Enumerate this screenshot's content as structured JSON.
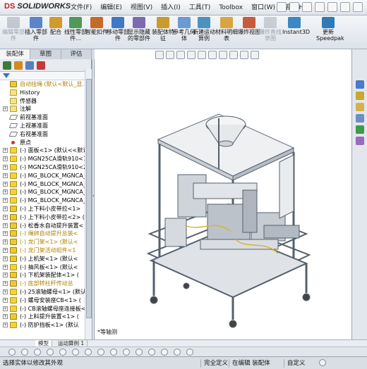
{
  "app": {
    "logo_prefix": "DS",
    "logo_name": "SOLIDWORKS"
  },
  "menu": [
    "文件(F)",
    "编辑(E)",
    "视图(V)",
    "插入(I)",
    "工具(T)",
    "Toolbox",
    "窗口(W)",
    "帮助(H)"
  ],
  "ribbon": [
    {
      "label": "编辑零部件",
      "disabled": true,
      "icon": "edit-component-icon"
    },
    {
      "label": "插入零部件",
      "disabled": false,
      "icon": "insert-component-icon"
    },
    {
      "label": "配合",
      "disabled": false,
      "icon": "mate-icon"
    },
    {
      "label": "线性零部件...",
      "disabled": false,
      "icon": "linear-pattern-icon"
    },
    {
      "label": "智能扣件",
      "disabled": false,
      "icon": "smart-fastener-icon"
    },
    {
      "label": "移动零部件",
      "disabled": false,
      "icon": "move-component-icon"
    },
    {
      "label": "显示隐藏的零部件",
      "disabled": false,
      "icon": "show-hidden-icon"
    },
    {
      "label": "装配体特征",
      "disabled": false,
      "icon": "assembly-feature-icon"
    },
    {
      "label": "参考几何体",
      "disabled": false,
      "icon": "reference-geometry-icon"
    },
    {
      "label": "新建运动算例",
      "disabled": false,
      "icon": "motion-study-icon"
    },
    {
      "label": "材料明细表",
      "disabled": false,
      "icon": "bom-icon"
    },
    {
      "label": "爆炸视图",
      "disabled": false,
      "icon": "exploded-view-icon"
    },
    {
      "label": "爆炸直线草图",
      "disabled": true,
      "icon": "explode-line-icon"
    },
    {
      "label": "Instant3D",
      "disabled": false,
      "icon": "instant3d-icon"
    },
    {
      "label": "更新Speedpak",
      "disabled": false,
      "icon": "speedpak-icon"
    }
  ],
  "panel_tabs": [
    "装配体",
    "草图",
    "评估"
  ],
  "tree": [
    {
      "text": "自动挂绳 (默认<默认_显...",
      "kind": "asm",
      "exp": "",
      "hl": true
    },
    {
      "text": "History",
      "kind": "fol",
      "exp": ""
    },
    {
      "text": "传感器",
      "kind": "fol",
      "exp": ""
    },
    {
      "text": "注解",
      "kind": "fol",
      "exp": "+"
    },
    {
      "text": "前视基准面",
      "kind": "pln",
      "exp": ""
    },
    {
      "text": "上视基准面",
      "kind": "pln",
      "exp": ""
    },
    {
      "text": "右视基准面",
      "kind": "pln",
      "exp": ""
    },
    {
      "text": "原点",
      "kind": "org",
      "exp": ""
    },
    {
      "text": "(-) 面板<1> (默认<<默认",
      "kind": "yel",
      "exp": "+"
    },
    {
      "text": "(-) MGN25CA滑轨910<1> (",
      "kind": "yel",
      "exp": "+"
    },
    {
      "text": "(-) MGN25CA滑轨910<2> (",
      "kind": "yel",
      "exp": "+"
    },
    {
      "text": "(-) MG_BLOCK_MGNCA_ANT_",
      "kind": "yel",
      "exp": "+"
    },
    {
      "text": "(-) MG_BLOCK_MGNCA_ANT_",
      "kind": "yel",
      "exp": "+"
    },
    {
      "text": "(-) MG_BLOCK_MGNCA_ANT_",
      "kind": "yel",
      "exp": "+"
    },
    {
      "text": "(-) MG_BLOCK_MGNCA_ANT_",
      "kind": "yel",
      "exp": "+"
    },
    {
      "text": "(-) 上下料小皮带拉<1>",
      "kind": "asm",
      "exp": "+"
    },
    {
      "text": "(-) 上下料小皮带拉<2> (",
      "kind": "asm",
      "exp": "+"
    },
    {
      "text": "(-) 松香水自动提升装置<",
      "kind": "asm",
      "exp": "+"
    },
    {
      "text": "(-) 绳卵自动提升总装<",
      "kind": "asm",
      "exp": "+",
      "hl": true
    },
    {
      "text": "(-) 龙门架<1> (默认<",
      "kind": "asm",
      "exp": "+",
      "hl": true
    },
    {
      "text": "(-) 龙门架活动组件<1",
      "kind": "asm",
      "exp": "+",
      "hl": true
    },
    {
      "text": "(-) 上机架<1> (默认<",
      "kind": "asm",
      "exp": "+"
    },
    {
      "text": "(-) 抽风板<1> (默认<",
      "kind": "yel",
      "exp": "+"
    },
    {
      "text": "(-) 下机架装配体<1> (",
      "kind": "asm",
      "exp": "+"
    },
    {
      "text": "(-) 底部转柱杆传动总",
      "kind": "asm",
      "exp": "+",
      "hl": true
    },
    {
      "text": "(-) 25滚轴螺母<1> (默认",
      "kind": "yel",
      "exp": "+"
    },
    {
      "text": "(-) 螺母安装座CB<1> (",
      "kind": "yel",
      "exp": "+"
    },
    {
      "text": "(-) CB滚轴螺母座连接板<",
      "kind": "yel",
      "exp": "+"
    },
    {
      "text": "(-) 上料提升装置<1> (",
      "kind": "asm",
      "exp": "+"
    },
    {
      "text": "(-) 防护挡板<1> (默认",
      "kind": "yel",
      "exp": "+"
    }
  ],
  "viewport": {
    "view_label": "*等轴测"
  },
  "bottom_tabs": [
    "模型",
    "运动算例 1"
  ],
  "status": {
    "left": "选择实体以修改其外观",
    "def": "完全定义",
    "edit": "在编辑 装配体",
    "custom": "自定义"
  },
  "colors": {
    "accent": "#c81e1e",
    "highlight": "#b08000",
    "frame": "#7a8490"
  }
}
